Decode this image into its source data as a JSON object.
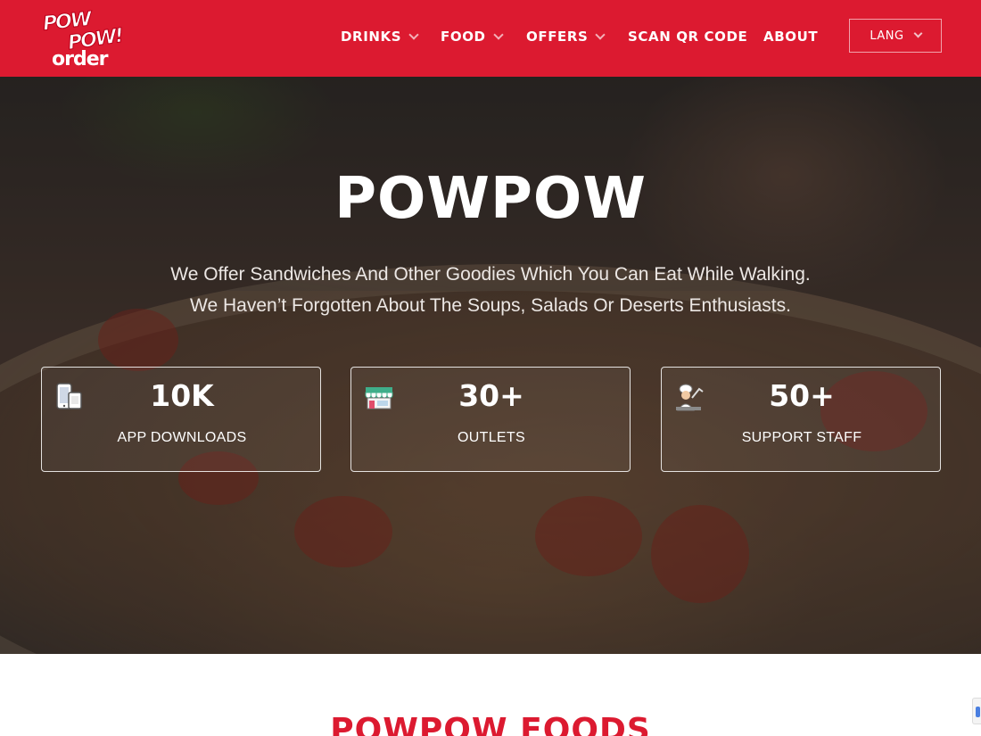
{
  "brand": {
    "logo_line1": "POW",
    "logo_line2": "POW!",
    "logo_line3": "order",
    "primary_color": "#dc1a30"
  },
  "nav": {
    "items": [
      {
        "label": "DRINKS",
        "has_dropdown": true
      },
      {
        "label": "FOOD",
        "has_dropdown": true
      },
      {
        "label": "OFFERS",
        "has_dropdown": true
      },
      {
        "label": "SCAN QR CODE",
        "has_dropdown": false
      },
      {
        "label": "ABOUT",
        "has_dropdown": false
      }
    ],
    "lang_label": "LANG"
  },
  "hero": {
    "title": "POWPOW",
    "subtitle_line1": "We Offer Sandwiches And Other Goodies Which You Can Eat While Walking.",
    "subtitle_line2": "We Haven’t Forgotten About The Soups, Salads Or Deserts Enthusiasts."
  },
  "stats": [
    {
      "icon": "mobile-app-icon",
      "value": "10K",
      "label": "APP DOWNLOADS"
    },
    {
      "icon": "storefront-icon",
      "value": "30+",
      "label": "OUTLETS"
    },
    {
      "icon": "chef-icon",
      "value": "50+",
      "label": "SUPPORT STAFF"
    }
  ],
  "section": {
    "title": "POWPOW FOODS"
  }
}
